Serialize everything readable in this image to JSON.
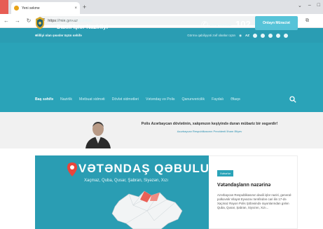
{
  "browser": {
    "tab_title": "Yeni sekme",
    "tab_close": "×",
    "newtab_symbol": "+",
    "url": "https://mia.gov.az",
    "window_controls": [
      "⌄",
      "–",
      "□"
    ]
  },
  "site_top": {
    "accessibility_link": "Əlilliyi olan şəxslər üçün səhifə",
    "visually_impaired_label": "Görmə qabiliyyəti zəif olanlar üçün",
    "language": "AZ"
  },
  "header": {
    "brand_subtitle": "Azərbaycan Respublikası",
    "brand_title": "Daxili İşlər Nazirliyi",
    "hotline_label": "Zəng mərkəzi",
    "hotline_number": "102",
    "ecall_button": "Onlayn Müraciət"
  },
  "nav": {
    "items": [
      {
        "label": "Baş səhifə",
        "active": true
      },
      {
        "label": "Nazirlik",
        "active": false
      },
      {
        "label": "Mətbuat xidməti",
        "active": false
      },
      {
        "label": "Dövlət xidmətləri",
        "active": false
      },
      {
        "label": "Vətəndaş və Polis",
        "active": false
      },
      {
        "label": "Qanunvericilik",
        "active": false
      },
      {
        "label": "Faydalı",
        "active": false
      },
      {
        "label": "Əlaqə",
        "active": false
      }
    ]
  },
  "quote": {
    "text": "Polis Azərbaycan dövlətinin, xalqımızın keşiyində duran mübariz bir əsgərdir!",
    "author": "Azərbaycan Respublikasının Prezidenti İlham Əliyev"
  },
  "banner": {
    "title": "VƏTƏNDAŞ QƏBULU",
    "cities": "Xaçmaz, Quba, Qusar, Şabran, Siyəzən, Xızı"
  },
  "news": {
    "tag": "Xəbərlər",
    "title": "Vətəndaşların nəzərinə",
    "body": "Azərbaycan Respublikasının daxili işlər naziri, general-polkovnik Vilayət Eyvazov tərəfindən cari ilin 17-də Xaçmaz Rayon Polis Şöbəsində rayonlarından gələn Quba, Qusar, Şabran, Siyəzən, Xızı..."
  },
  "colors": {
    "brand_teal": "#2aa3b8",
    "button_teal": "#56c3d8",
    "pin_red": "#e9453b"
  }
}
